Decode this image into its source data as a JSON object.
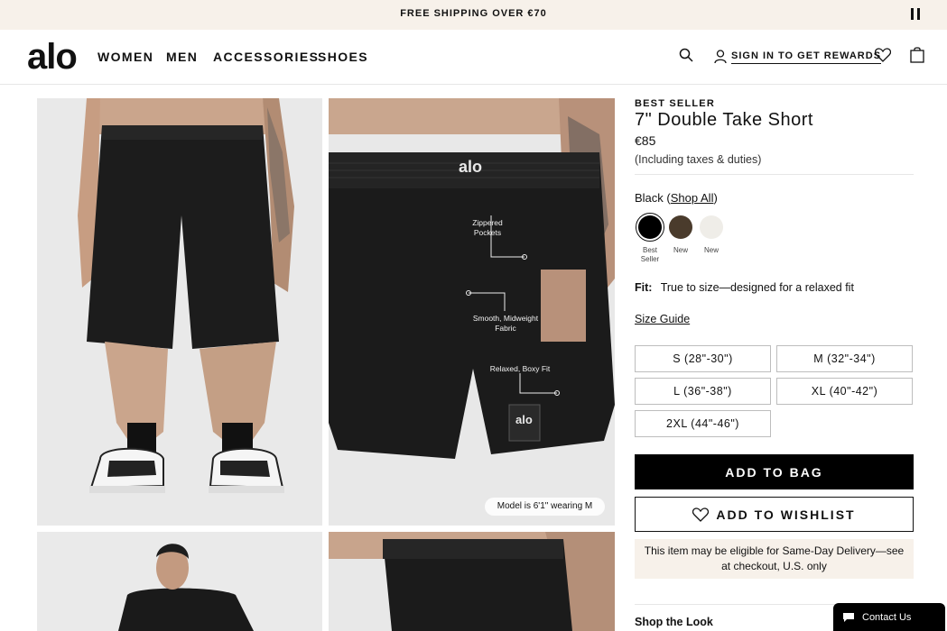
{
  "promo": {
    "text": "FREE SHIPPING OVER €70",
    "pause_icon": "pause-icon"
  },
  "header": {
    "logo": "alo",
    "nav": [
      "WOMEN",
      "MEN",
      "ACCESSORIES",
      "SHOES"
    ],
    "signin_label": "SIGN IN TO GET REWARDS",
    "icons": [
      "search-icon",
      "user-icon",
      "heart-icon",
      "bag-icon"
    ]
  },
  "gallery": {
    "annotations": [
      "Zippered Pockets",
      "Smooth, Midweight Fabric",
      "Relaxed, Boxy Fit"
    ],
    "waistband_logo": "alo",
    "patch_logo": "alo",
    "model_note": "Model is 6'1\" wearing M"
  },
  "product": {
    "badge": "BEST SELLER",
    "title": "7\" Double Take Short",
    "price": "€85",
    "tax_note": "(Including taxes & duties)",
    "color_name": "Black",
    "shop_all": "Shop All",
    "swatches": [
      {
        "color": "#000000",
        "caption": "Best Seller",
        "selected": true
      },
      {
        "color": "#4a3b2c",
        "caption": "New",
        "selected": false
      },
      {
        "color": "#efede8",
        "caption": "New",
        "selected": false
      }
    ],
    "fit_label": "Fit:",
    "fit_text": "True to size—designed for a relaxed fit",
    "size_guide": "Size Guide",
    "sizes": [
      "S (28\"-30\")",
      "M (32\"-34\")",
      "L (36\"-38\")",
      "XL (40\"-42\")",
      "2XL (44\"-46\")"
    ],
    "add_to_bag": "ADD TO BAG",
    "add_to_wishlist": "ADD TO WISHLIST",
    "delivery_note": "This item may be eligible for Same-Day Delivery—see at checkout, U.S. only",
    "shop_the_look": "Shop the Look"
  },
  "contact": {
    "label": "Contact Us",
    "icon": "chat-icon"
  },
  "colors": {
    "promo_bg": "#f7f1ea",
    "accent": "#000000",
    "delivery_bg": "#f7f1ea"
  }
}
